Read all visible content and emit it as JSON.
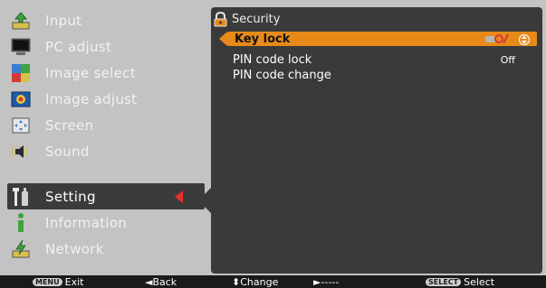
{
  "menu": {
    "items": [
      {
        "label": "Input",
        "icon": "input-icon"
      },
      {
        "label": "PC adjust",
        "icon": "pc-adjust-icon"
      },
      {
        "label": "Image select",
        "icon": "image-select-icon"
      },
      {
        "label": "Image adjust",
        "icon": "image-adjust-icon"
      },
      {
        "label": "Screen",
        "icon": "screen-icon"
      },
      {
        "label": "Sound",
        "icon": "sound-icon"
      },
      {
        "label": "Setting",
        "icon": "setting-icon"
      },
      {
        "label": "Information",
        "icon": "information-icon"
      },
      {
        "label": "Network",
        "icon": "network-icon"
      }
    ],
    "active_index": 6
  },
  "panel": {
    "title": "Security",
    "rows": [
      {
        "label": "Key lock",
        "value": "",
        "selected": true
      },
      {
        "label": "PIN code lock",
        "value": "Off",
        "selected": false
      },
      {
        "label": "PIN code change",
        "value": "",
        "selected": false
      }
    ]
  },
  "bottom": {
    "exit_key": "MENU",
    "exit_label": "Exit",
    "back_label": "◄Back",
    "change_label": "⬍Change",
    "next_label": "►-----",
    "select_key": "SELECT",
    "select_label": "Select"
  },
  "colors": {
    "highlight": "#e78a1a",
    "active_arrow": "#e8302c",
    "panel_bg": "#3a3a3a",
    "menu_bg": "#c3c3c3"
  }
}
